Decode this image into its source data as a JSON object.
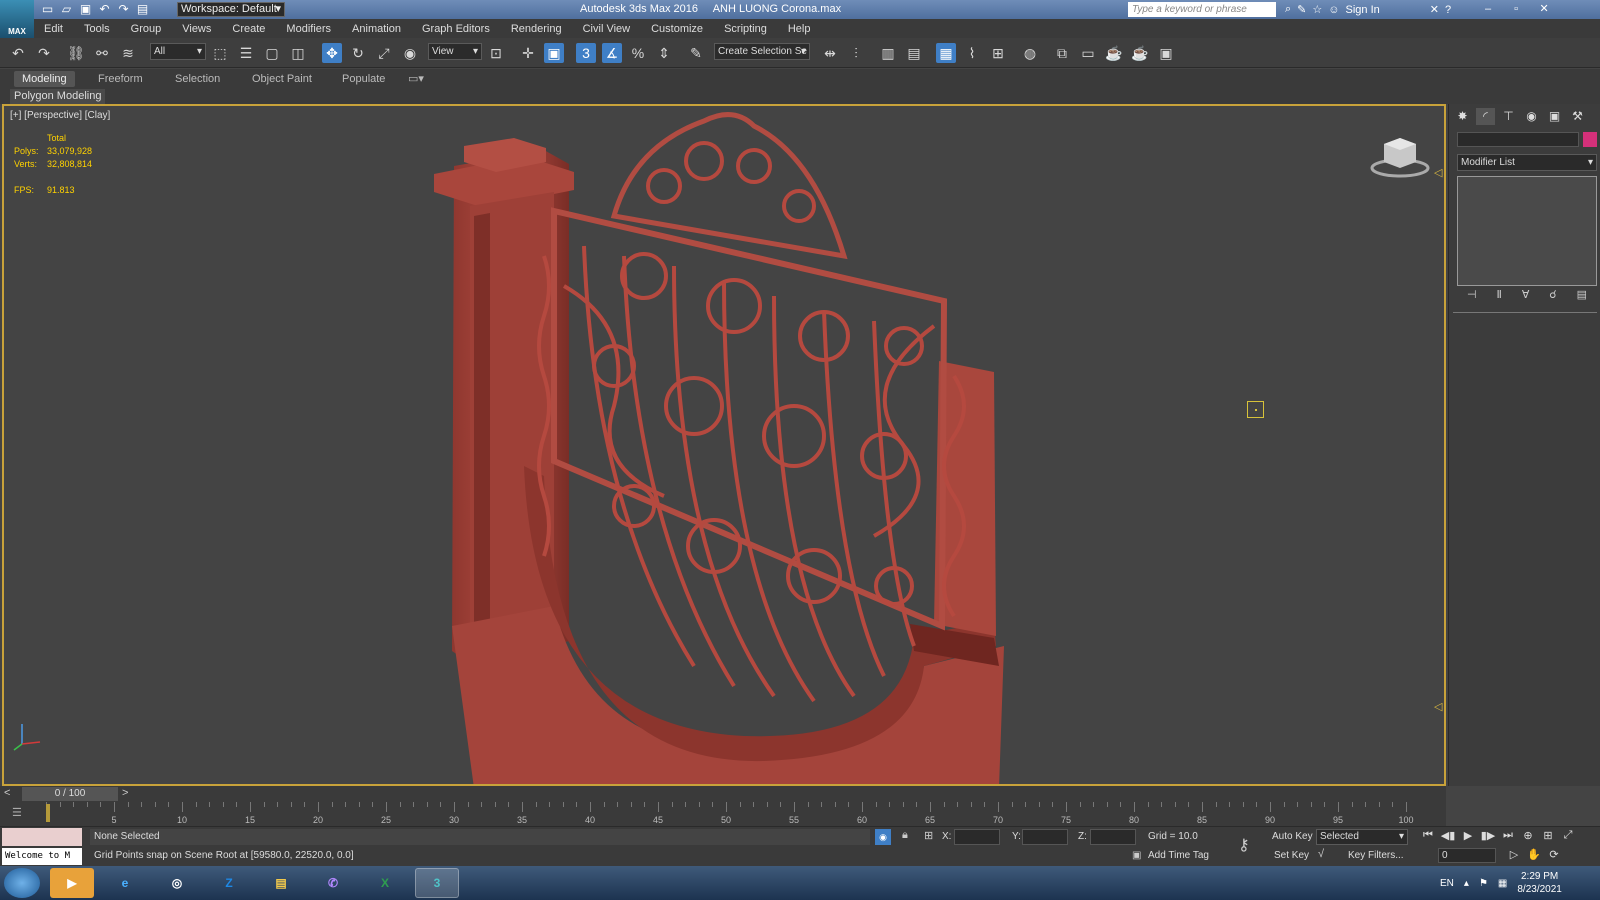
{
  "titlebar": {
    "app_logo_text": "MAX",
    "workspace": "Workspace: Default",
    "app_title": "Autodesk 3ds Max 2016",
    "file_title": "ANH LUONG Corona.max",
    "search_placeholder": "Type a keyword or phrase",
    "sign_in": "Sign In"
  },
  "menu": [
    "Edit",
    "Tools",
    "Group",
    "Views",
    "Create",
    "Modifiers",
    "Animation",
    "Graph Editors",
    "Rendering",
    "Civil View",
    "Customize",
    "Scripting",
    "Help"
  ],
  "toolbar": {
    "filter": "All",
    "ref_coord": "View",
    "selection_set": "Create Selection Se"
  },
  "ribbon": {
    "tabs": [
      "Modeling",
      "Freeform",
      "Selection",
      "Object Paint",
      "Populate"
    ],
    "active_tab": "Modeling",
    "panel_label": "Polygon Modeling"
  },
  "viewport": {
    "label": "[+] [Perspective] [Clay]",
    "stats_header": "Total",
    "polys_label": "Polys:",
    "polys_value": "33,079,928",
    "verts_label": "Verts:",
    "verts_value": "32,808,814",
    "fps_label": "FPS:",
    "fps_value": "91.813",
    "model_color": "#a8453c",
    "selection_color": "#c8a23a"
  },
  "command_panel": {
    "modifier_list": "Modifier List",
    "object_color": "#d4307a"
  },
  "timeline": {
    "frame_display": "0 / 100",
    "ticks": [
      5,
      10,
      15,
      20,
      25,
      30,
      35,
      40,
      45,
      50,
      55,
      60,
      65,
      70,
      75,
      80,
      85,
      90,
      95,
      100
    ]
  },
  "status": {
    "welcome": "Welcome to M",
    "selection": "None Selected",
    "prompt": "Grid Points snap on Scene Root at [59580.0, 22520.0, 0.0]",
    "x_label": "X:",
    "y_label": "Y:",
    "z_label": "Z:",
    "grid": "Grid = 10.0",
    "add_time_tag": "Add Time Tag",
    "auto_key": "Auto Key",
    "set_key": "Set Key",
    "key_mode": "Selected",
    "key_filters": "Key Filters...",
    "current_frame": "0"
  },
  "taskbar": {
    "apps": [
      "Media Player",
      "Internet Explorer",
      "Chrome",
      "Zalo",
      "File Explorer",
      "Viber",
      "Excel",
      "3ds Max"
    ],
    "language": "EN",
    "time": "2:29 PM",
    "date": "8/23/2021"
  }
}
